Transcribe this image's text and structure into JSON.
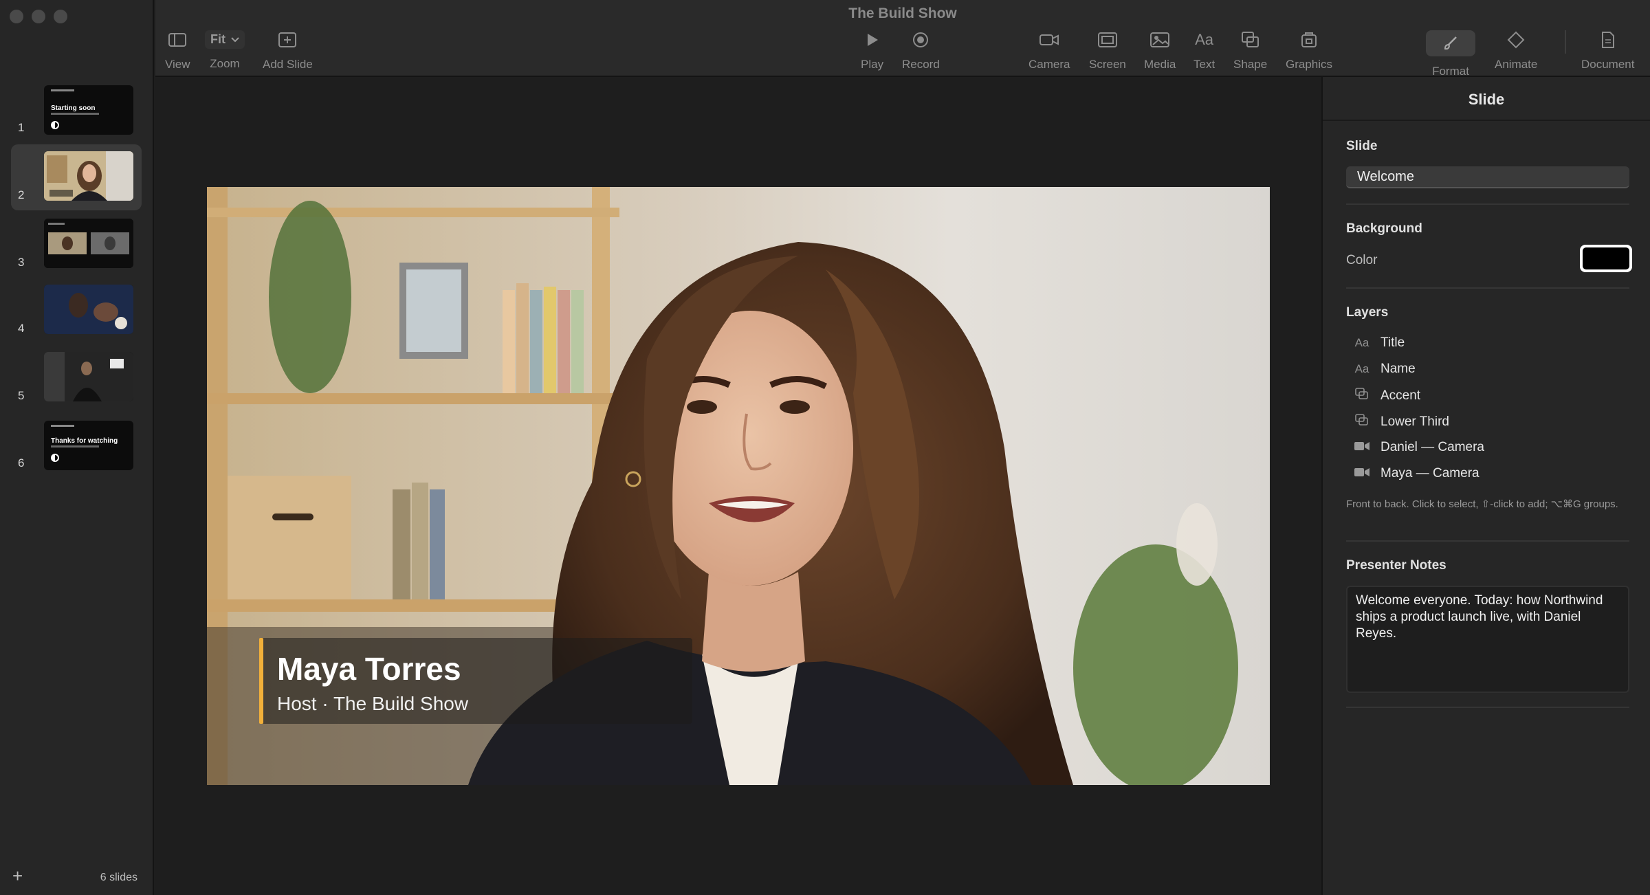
{
  "window": {
    "title": "The Build Show"
  },
  "toolbar": {
    "view": "View",
    "zoom_value": "Fit",
    "zoom": "Zoom",
    "add_slide": "Add Slide",
    "play": "Play",
    "record": "Record",
    "camera": "Camera",
    "screen": "Screen",
    "media": "Media",
    "text": "Text",
    "text_icon": "Aa",
    "shape": "Shape",
    "graphics": "Graphics",
    "format": "Format",
    "animate": "Animate",
    "document": "Document"
  },
  "sidebar": {
    "slides": [
      {
        "num": "1",
        "title": "Starting soon",
        "kind": "title"
      },
      {
        "num": "2",
        "title": "",
        "kind": "camera",
        "selected": true
      },
      {
        "num": "3",
        "title": "",
        "kind": "two-up"
      },
      {
        "num": "4",
        "title": "",
        "kind": "media"
      },
      {
        "num": "5",
        "title": "",
        "kind": "media"
      },
      {
        "num": "6",
        "title": "Thanks for watching",
        "kind": "title"
      }
    ],
    "add_icon": "+",
    "count_label": "6 slides"
  },
  "slide": {
    "lower_third_name": "Maya Torres",
    "lower_third_title": "Host · The Build Show",
    "accent_color": "#f2b03a"
  },
  "inspector": {
    "header": "Slide",
    "slide_section": "Slide",
    "slide_name": "Welcome",
    "background_section": "Background",
    "color_label": "Color",
    "background_color": "#000000",
    "layers_section": "Layers",
    "layers": [
      {
        "icon": "text-icon",
        "glyph": "Aa",
        "name": "Title"
      },
      {
        "icon": "text-icon",
        "glyph": "Aa",
        "name": "Name"
      },
      {
        "icon": "shape-icon",
        "glyph": "⧉",
        "name": "Accent"
      },
      {
        "icon": "shape-icon",
        "glyph": "⧉",
        "name": "Lower Third"
      },
      {
        "icon": "camera-icon",
        "glyph": "■",
        "name": "Daniel — Camera"
      },
      {
        "icon": "camera-icon",
        "glyph": "■",
        "name": "Maya — Camera"
      }
    ],
    "layers_help": "Front to back. Click to select, ⇧-click to add; ⌥⌘G groups.",
    "notes_section": "Presenter Notes",
    "notes_text": "Welcome everyone. Today: how Northwind ships a product launch live, with Daniel Reyes."
  }
}
